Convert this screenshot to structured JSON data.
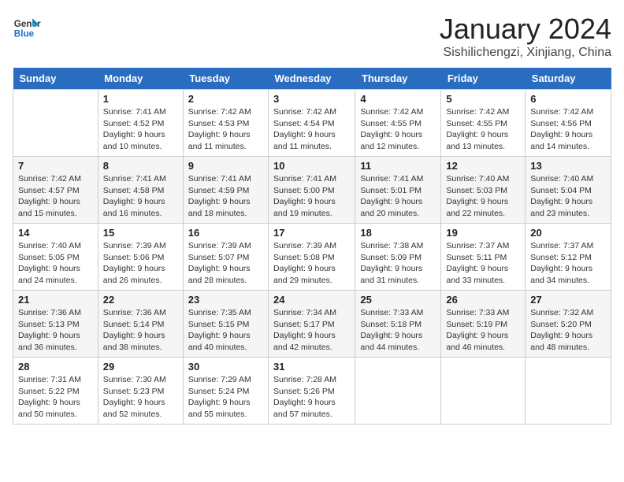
{
  "header": {
    "logo_line1": "General",
    "logo_line2": "Blue",
    "title": "January 2024",
    "subtitle": "Sishilichengzi, Xinjiang, China"
  },
  "weekdays": [
    "Sunday",
    "Monday",
    "Tuesday",
    "Wednesday",
    "Thursday",
    "Friday",
    "Saturday"
  ],
  "weeks": [
    [
      {
        "day": "",
        "sunrise": "",
        "sunset": "",
        "daylight": ""
      },
      {
        "day": "1",
        "sunrise": "Sunrise: 7:41 AM",
        "sunset": "Sunset: 4:52 PM",
        "daylight": "Daylight: 9 hours and 10 minutes."
      },
      {
        "day": "2",
        "sunrise": "Sunrise: 7:42 AM",
        "sunset": "Sunset: 4:53 PM",
        "daylight": "Daylight: 9 hours and 11 minutes."
      },
      {
        "day": "3",
        "sunrise": "Sunrise: 7:42 AM",
        "sunset": "Sunset: 4:54 PM",
        "daylight": "Daylight: 9 hours and 11 minutes."
      },
      {
        "day": "4",
        "sunrise": "Sunrise: 7:42 AM",
        "sunset": "Sunset: 4:55 PM",
        "daylight": "Daylight: 9 hours and 12 minutes."
      },
      {
        "day": "5",
        "sunrise": "Sunrise: 7:42 AM",
        "sunset": "Sunset: 4:55 PM",
        "daylight": "Daylight: 9 hours and 13 minutes."
      },
      {
        "day": "6",
        "sunrise": "Sunrise: 7:42 AM",
        "sunset": "Sunset: 4:56 PM",
        "daylight": "Daylight: 9 hours and 14 minutes."
      }
    ],
    [
      {
        "day": "7",
        "sunrise": "Sunrise: 7:42 AM",
        "sunset": "Sunset: 4:57 PM",
        "daylight": "Daylight: 9 hours and 15 minutes."
      },
      {
        "day": "8",
        "sunrise": "Sunrise: 7:41 AM",
        "sunset": "Sunset: 4:58 PM",
        "daylight": "Daylight: 9 hours and 16 minutes."
      },
      {
        "day": "9",
        "sunrise": "Sunrise: 7:41 AM",
        "sunset": "Sunset: 4:59 PM",
        "daylight": "Daylight: 9 hours and 18 minutes."
      },
      {
        "day": "10",
        "sunrise": "Sunrise: 7:41 AM",
        "sunset": "Sunset: 5:00 PM",
        "daylight": "Daylight: 9 hours and 19 minutes."
      },
      {
        "day": "11",
        "sunrise": "Sunrise: 7:41 AM",
        "sunset": "Sunset: 5:01 PM",
        "daylight": "Daylight: 9 hours and 20 minutes."
      },
      {
        "day": "12",
        "sunrise": "Sunrise: 7:40 AM",
        "sunset": "Sunset: 5:03 PM",
        "daylight": "Daylight: 9 hours and 22 minutes."
      },
      {
        "day": "13",
        "sunrise": "Sunrise: 7:40 AM",
        "sunset": "Sunset: 5:04 PM",
        "daylight": "Daylight: 9 hours and 23 minutes."
      }
    ],
    [
      {
        "day": "14",
        "sunrise": "Sunrise: 7:40 AM",
        "sunset": "Sunset: 5:05 PM",
        "daylight": "Daylight: 9 hours and 24 minutes."
      },
      {
        "day": "15",
        "sunrise": "Sunrise: 7:39 AM",
        "sunset": "Sunset: 5:06 PM",
        "daylight": "Daylight: 9 hours and 26 minutes."
      },
      {
        "day": "16",
        "sunrise": "Sunrise: 7:39 AM",
        "sunset": "Sunset: 5:07 PM",
        "daylight": "Daylight: 9 hours and 28 minutes."
      },
      {
        "day": "17",
        "sunrise": "Sunrise: 7:39 AM",
        "sunset": "Sunset: 5:08 PM",
        "daylight": "Daylight: 9 hours and 29 minutes."
      },
      {
        "day": "18",
        "sunrise": "Sunrise: 7:38 AM",
        "sunset": "Sunset: 5:09 PM",
        "daylight": "Daylight: 9 hours and 31 minutes."
      },
      {
        "day": "19",
        "sunrise": "Sunrise: 7:37 AM",
        "sunset": "Sunset: 5:11 PM",
        "daylight": "Daylight: 9 hours and 33 minutes."
      },
      {
        "day": "20",
        "sunrise": "Sunrise: 7:37 AM",
        "sunset": "Sunset: 5:12 PM",
        "daylight": "Daylight: 9 hours and 34 minutes."
      }
    ],
    [
      {
        "day": "21",
        "sunrise": "Sunrise: 7:36 AM",
        "sunset": "Sunset: 5:13 PM",
        "daylight": "Daylight: 9 hours and 36 minutes."
      },
      {
        "day": "22",
        "sunrise": "Sunrise: 7:36 AM",
        "sunset": "Sunset: 5:14 PM",
        "daylight": "Daylight: 9 hours and 38 minutes."
      },
      {
        "day": "23",
        "sunrise": "Sunrise: 7:35 AM",
        "sunset": "Sunset: 5:15 PM",
        "daylight": "Daylight: 9 hours and 40 minutes."
      },
      {
        "day": "24",
        "sunrise": "Sunrise: 7:34 AM",
        "sunset": "Sunset: 5:17 PM",
        "daylight": "Daylight: 9 hours and 42 minutes."
      },
      {
        "day": "25",
        "sunrise": "Sunrise: 7:33 AM",
        "sunset": "Sunset: 5:18 PM",
        "daylight": "Daylight: 9 hours and 44 minutes."
      },
      {
        "day": "26",
        "sunrise": "Sunrise: 7:33 AM",
        "sunset": "Sunset: 5:19 PM",
        "daylight": "Daylight: 9 hours and 46 minutes."
      },
      {
        "day": "27",
        "sunrise": "Sunrise: 7:32 AM",
        "sunset": "Sunset: 5:20 PM",
        "daylight": "Daylight: 9 hours and 48 minutes."
      }
    ],
    [
      {
        "day": "28",
        "sunrise": "Sunrise: 7:31 AM",
        "sunset": "Sunset: 5:22 PM",
        "daylight": "Daylight: 9 hours and 50 minutes."
      },
      {
        "day": "29",
        "sunrise": "Sunrise: 7:30 AM",
        "sunset": "Sunset: 5:23 PM",
        "daylight": "Daylight: 9 hours and 52 minutes."
      },
      {
        "day": "30",
        "sunrise": "Sunrise: 7:29 AM",
        "sunset": "Sunset: 5:24 PM",
        "daylight": "Daylight: 9 hours and 55 minutes."
      },
      {
        "day": "31",
        "sunrise": "Sunrise: 7:28 AM",
        "sunset": "Sunset: 5:26 PM",
        "daylight": "Daylight: 9 hours and 57 minutes."
      },
      {
        "day": "",
        "sunrise": "",
        "sunset": "",
        "daylight": ""
      },
      {
        "day": "",
        "sunrise": "",
        "sunset": "",
        "daylight": ""
      },
      {
        "day": "",
        "sunrise": "",
        "sunset": "",
        "daylight": ""
      }
    ]
  ]
}
